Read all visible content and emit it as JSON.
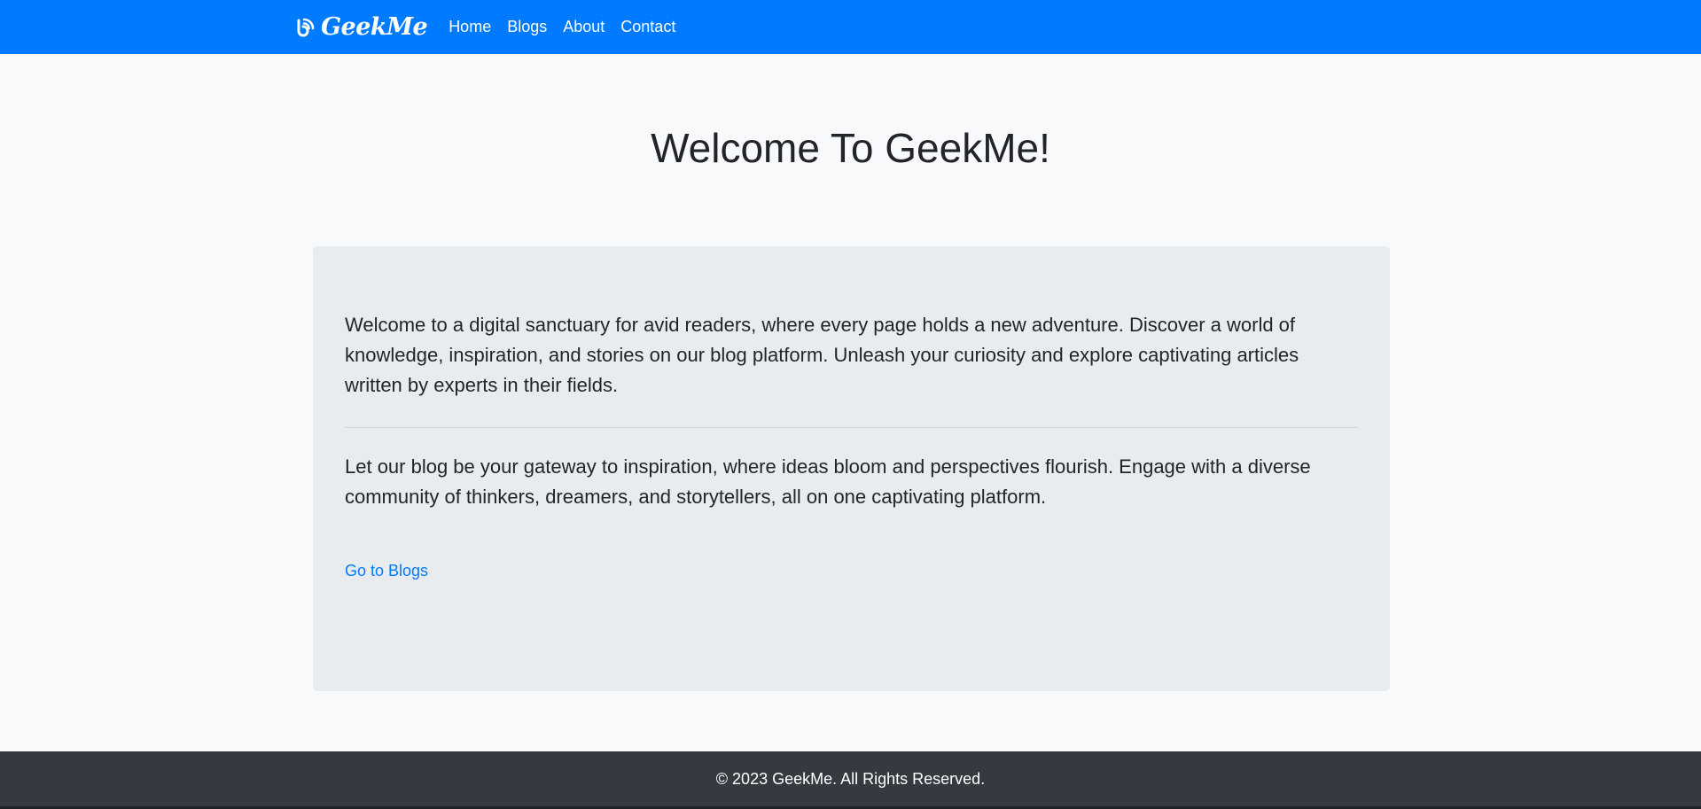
{
  "navbar": {
    "brand": "GeekMe",
    "brand_icon": "blog-rss-icon",
    "links": [
      {
        "label": "Home"
      },
      {
        "label": "Blogs"
      },
      {
        "label": "About"
      },
      {
        "label": "Contact"
      }
    ],
    "background": "#007bff"
  },
  "hero": {
    "title": "Welcome To GeekMe!"
  },
  "jumbotron": {
    "paragraph1": "Welcome to a digital sanctuary for avid readers, where every page holds a new adventure. Discover a world of knowledge, inspiration, and stories on our blog platform. Unleash your curiosity and explore captivating articles written by experts in their fields.",
    "paragraph2": "Let our blog be your gateway to inspiration, where ideas bloom and perspectives flourish. Engage with a diverse community of thinkers, dreamers, and storytellers, all on one captivating platform.",
    "link_label": "Go to Blogs",
    "link_color": "#007bff",
    "background": "#e9ecef"
  },
  "footer": {
    "text": "© 2023 GeekMe. All Rights Reserved.",
    "background": "#343a40"
  }
}
